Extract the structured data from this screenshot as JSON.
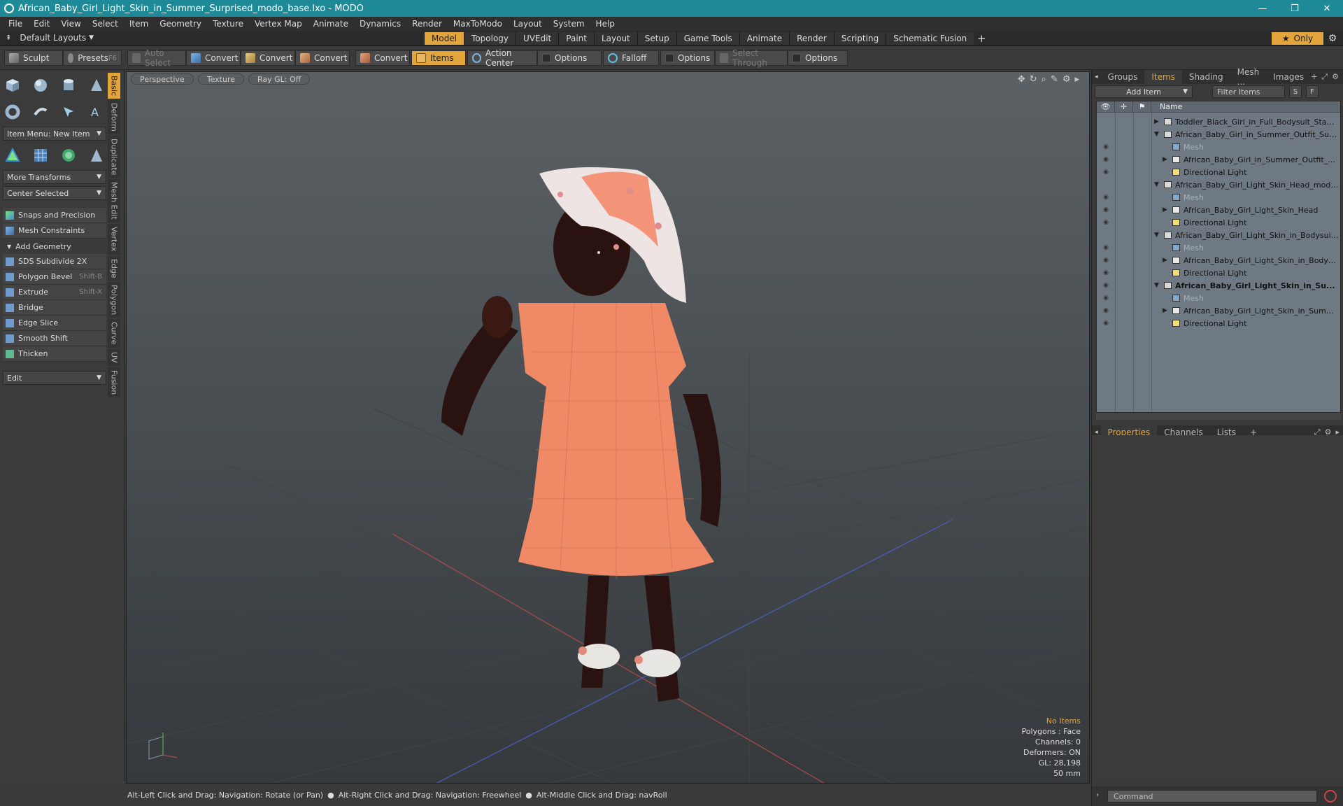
{
  "window": {
    "title": "African_Baby_Girl_Light_Skin_in_Summer_Surprised_modo_base.lxo - MODO",
    "minimize": "—",
    "maximize": "❐",
    "close": "✕"
  },
  "menu": [
    "File",
    "Edit",
    "View",
    "Select",
    "Item",
    "Geometry",
    "Texture",
    "Vertex Map",
    "Animate",
    "Dynamics",
    "Render",
    "MaxToModo",
    "Layout",
    "System",
    "Help"
  ],
  "layout_bar": {
    "default_layouts": "Default Layouts",
    "tabs": [
      "Model",
      "Topology",
      "UVEdit",
      "Paint",
      "Layout",
      "Setup",
      "Game Tools",
      "Animate",
      "Render",
      "Scripting",
      "Schematic Fusion"
    ],
    "active_tab": "Model",
    "only": "Only"
  },
  "toolbar": {
    "sculpt": "Sculpt",
    "presets": "Presets",
    "presets_key": "F6",
    "auto_select": "Auto Select",
    "convert1": "Convert",
    "convert2": "Convert",
    "convert3": "Convert",
    "convert4": "Convert",
    "items": "Items",
    "action_center": "Action Center",
    "options1": "Options",
    "falloff": "Falloff",
    "options2": "Options",
    "select_through": "Select Through",
    "options3": "Options"
  },
  "left_panel": {
    "item_menu": "Item Menu: New Item",
    "more_transforms": "More Transforms",
    "center_selected": "Center Selected",
    "snaps": "Snaps and Precision",
    "mesh_constraints": "Mesh Constraints",
    "add_geometry": "Add Geometry",
    "tools": [
      {
        "label": "SDS Subdivide 2X",
        "key": ""
      },
      {
        "label": "Polygon Bevel",
        "key": "Shift-B"
      },
      {
        "label": "Extrude",
        "key": "Shift-X"
      },
      {
        "label": "Bridge",
        "key": ""
      },
      {
        "label": "Edge Slice",
        "key": ""
      },
      {
        "label": "Smooth Shift",
        "key": ""
      },
      {
        "label": "Thicken",
        "key": ""
      }
    ],
    "edit": "Edit",
    "vtabs": [
      "Basic",
      "Deform",
      "Duplicate",
      "Mesh Edit",
      "Vertex",
      "Edge",
      "Polygon",
      "Curve",
      "UV",
      "Fusion"
    ]
  },
  "viewport": {
    "perspective": "Perspective",
    "texture": "Texture",
    "raygl": "Ray GL: Off",
    "info": {
      "no_items": "No Items",
      "polygons": "Polygons : Face",
      "channels": "Channels: 0",
      "deformers": "Deformers: ON",
      "gl": "GL: 28,198",
      "focal": "50 mm"
    }
  },
  "right_panel": {
    "tabs": [
      "Groups",
      "Items",
      "Shading",
      "Mesh ...",
      "Images"
    ],
    "active_tab": "Items",
    "add_item": "Add Item",
    "filter_items": "Filter Items",
    "s_btn": "S",
    "f_btn": "F",
    "name_col": "Name",
    "rows": [
      {
        "label": "Toddler_Black_Girl_in_Full_Bodysuit_Standi ...",
        "indent": 0,
        "type": "scene",
        "arrow": "▶",
        "eye": false,
        "bold": false,
        "sub": false
      },
      {
        "label": "African_Baby_Girl_in_Summer_Outfit_Surp ...",
        "indent": 0,
        "type": "scene",
        "arrow": "▼",
        "eye": false,
        "bold": false,
        "sub": false
      },
      {
        "label": "Mesh",
        "indent": 1,
        "type": "mesh",
        "arrow": "",
        "eye": true,
        "bold": false,
        "sub": true
      },
      {
        "label": "African_Baby_Girl_in_Summer_Outfit_Su...",
        "indent": 1,
        "type": "group",
        "arrow": "▶",
        "eye": true,
        "bold": false,
        "sub": false
      },
      {
        "label": "Directional Light",
        "indent": 1,
        "type": "light",
        "arrow": "",
        "eye": true,
        "bold": false,
        "sub": false
      },
      {
        "label": "African_Baby_Girl_Light_Skin_Head_modo ...",
        "indent": 0,
        "type": "scene",
        "arrow": "▼",
        "eye": false,
        "bold": false,
        "sub": false
      },
      {
        "label": "Mesh",
        "indent": 1,
        "type": "mesh",
        "arrow": "",
        "eye": true,
        "bold": false,
        "sub": true
      },
      {
        "label": "African_Baby_Girl_Light_Skin_Head",
        "indent": 1,
        "type": "group",
        "arrow": "▶",
        "eye": true,
        "bold": false,
        "sub": false
      },
      {
        "label": "Directional Light",
        "indent": 1,
        "type": "light",
        "arrow": "",
        "eye": true,
        "bold": false,
        "sub": false
      },
      {
        "label": "African_Baby_Girl_Light_Skin_in_Bodysuit_...",
        "indent": 0,
        "type": "scene",
        "arrow": "▼",
        "eye": false,
        "bold": false,
        "sub": false
      },
      {
        "label": "Mesh",
        "indent": 1,
        "type": "mesh",
        "arrow": "",
        "eye": true,
        "bold": false,
        "sub": true
      },
      {
        "label": "African_Baby_Girl_Light_Skin_in_Bodysu...",
        "indent": 1,
        "type": "group",
        "arrow": "▶",
        "eye": true,
        "bold": false,
        "sub": false
      },
      {
        "label": "Directional Light",
        "indent": 1,
        "type": "light",
        "arrow": "",
        "eye": true,
        "bold": false,
        "sub": false
      },
      {
        "label": "African_Baby_Girl_Light_Skin_in_Su...",
        "indent": 0,
        "type": "scene",
        "arrow": "▼",
        "eye": true,
        "bold": true,
        "sub": false
      },
      {
        "label": "Mesh",
        "indent": 1,
        "type": "mesh",
        "arrow": "",
        "eye": true,
        "bold": false,
        "sub": true
      },
      {
        "label": "African_Baby_Girl_Light_Skin_in_Summe ...",
        "indent": 1,
        "type": "group",
        "arrow": "▶",
        "eye": true,
        "bold": false,
        "sub": false
      },
      {
        "label": "Directional Light",
        "indent": 1,
        "type": "light",
        "arrow": "",
        "eye": true,
        "bold": false,
        "sub": false
      }
    ],
    "prop_tabs": [
      "Properties",
      "Channels",
      "Lists"
    ],
    "active_prop_tab": "Properties",
    "command_placeholder": "Command"
  },
  "status": {
    "hint1": "Alt-Left Click and Drag: Navigation: Rotate (or Pan)",
    "hint2": "Alt-Right Click and Drag: Navigation: Freewheel",
    "hint3": "Alt-Middle Click and Drag: navRoll"
  },
  "colors": {
    "accent": "#e2a53b",
    "titlebar": "#1e8a97"
  }
}
